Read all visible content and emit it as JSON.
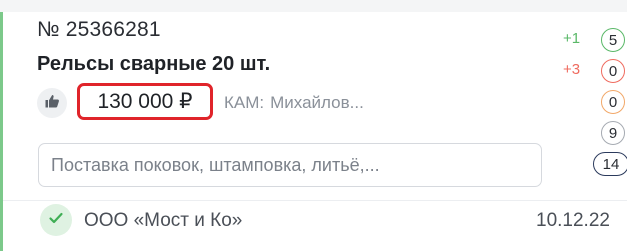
{
  "order": {
    "number": "№ 25366281",
    "title": "Рельсы сварные 20 шт.",
    "price": "130 000 ₽",
    "kam_label": "КАМ:",
    "kam_value": "Михайлов...",
    "description": "Поставка поковок, штамповка, литьё,..."
  },
  "footer": {
    "company": "ООО «Мост и Ко»",
    "date": "10.12.22"
  },
  "side_stats": {
    "delta_plus1": "+1",
    "delta_plus3": "+3",
    "badge_green": "5",
    "badge_red": "0",
    "badge_orange": "0",
    "badge_gray": "9",
    "badge_navy": "14"
  },
  "icons": {
    "like": "thumbs-up-icon",
    "status": "check-icon"
  },
  "colors": {
    "card_accent": "#7cc98a",
    "price_highlight": "#e0242a",
    "positive": "#5ab868",
    "negative": "#ef6b5f",
    "orange": "#f2a869",
    "navy": "#2b3a5c"
  }
}
